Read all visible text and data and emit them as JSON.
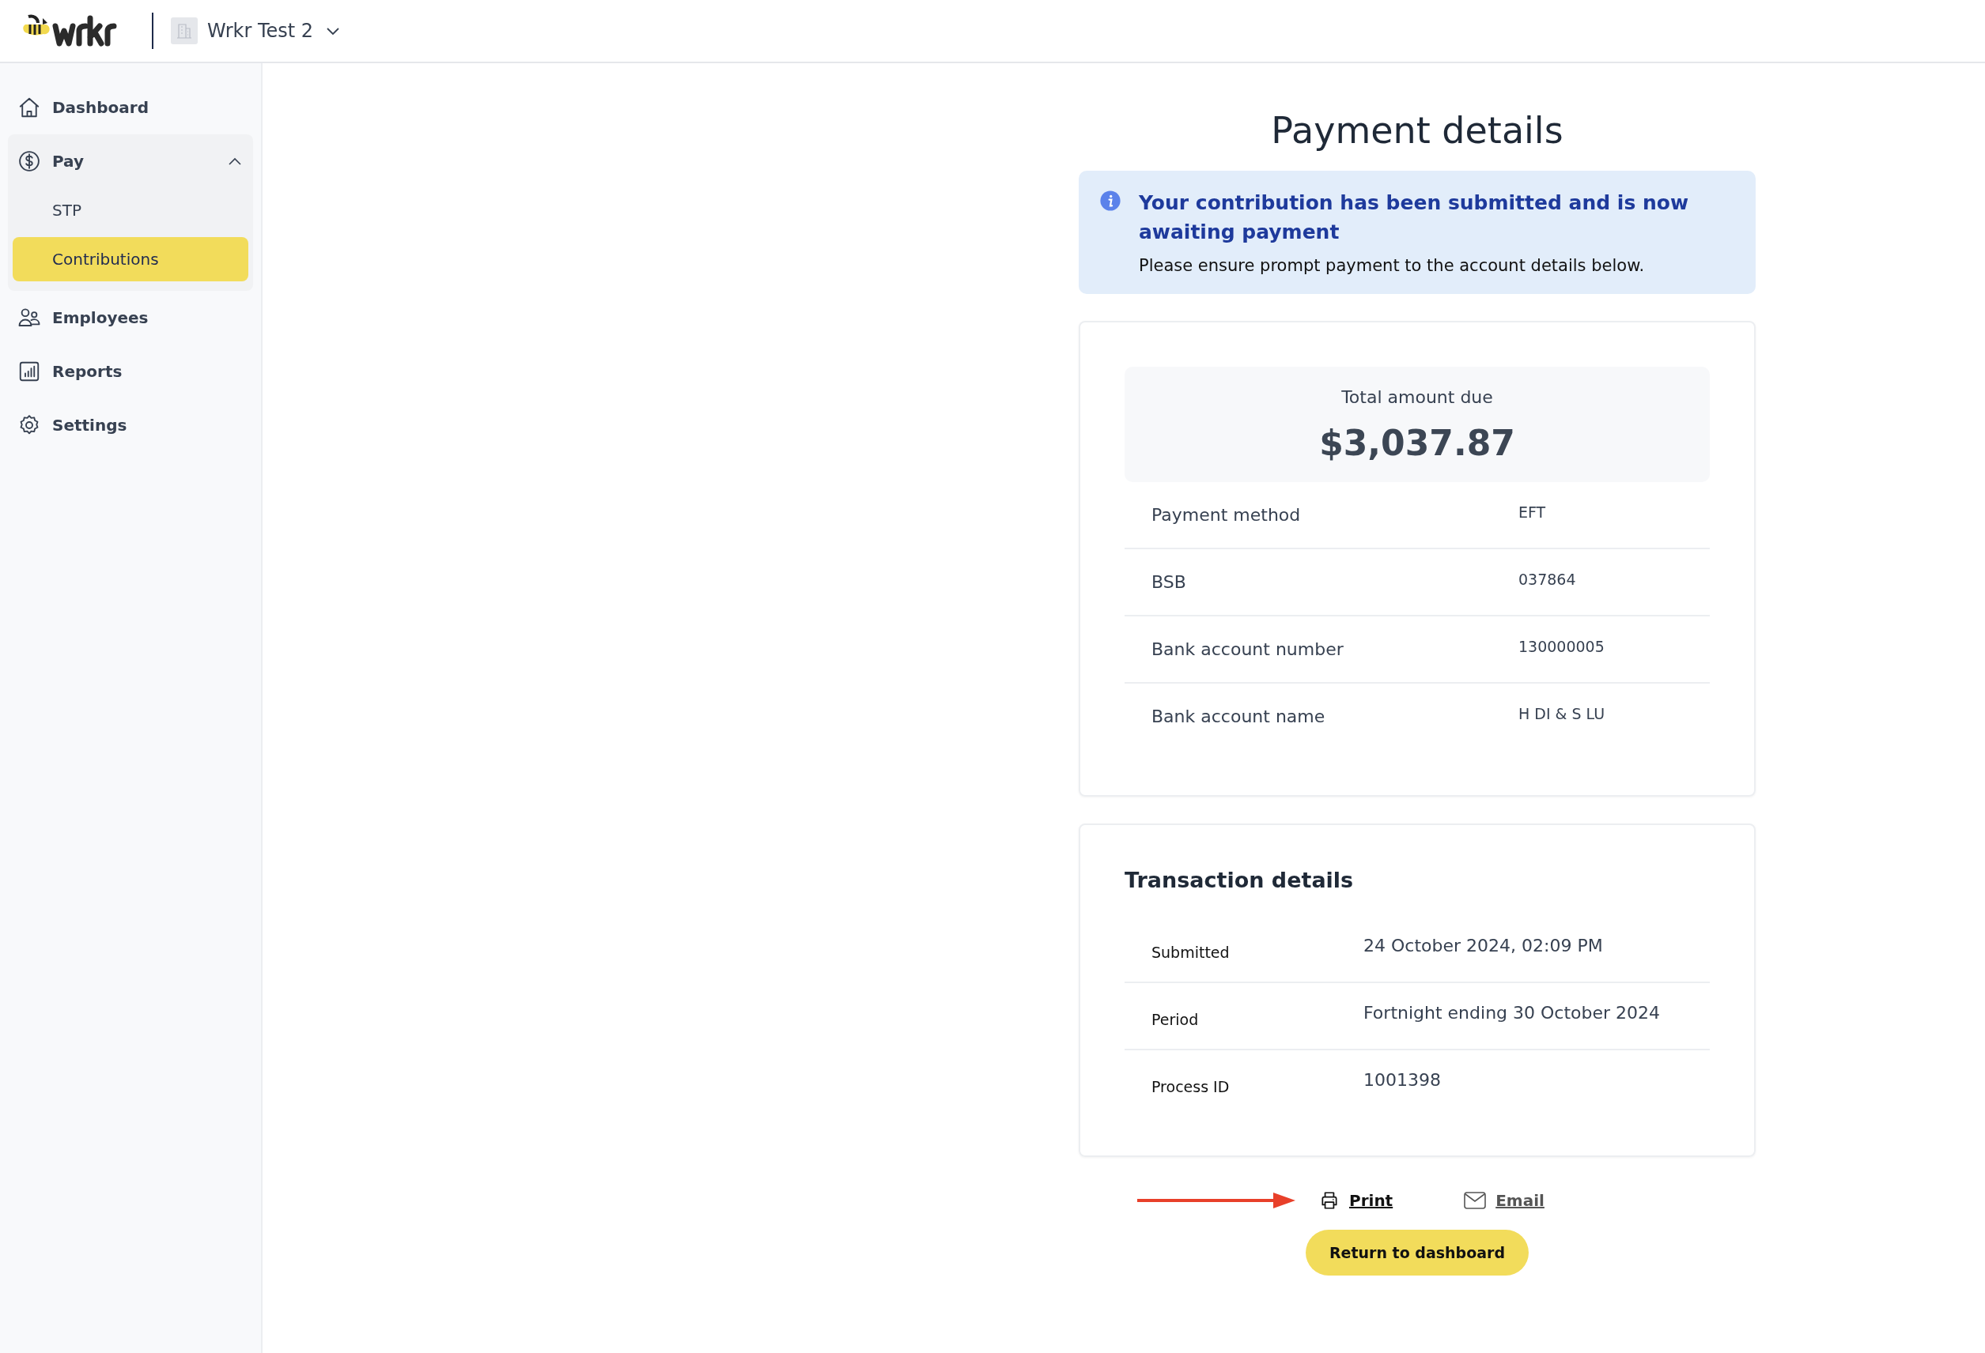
{
  "header": {
    "workspace": "Wrkr Test 2"
  },
  "sidebar": {
    "items": [
      {
        "label": "Dashboard",
        "selected": false
      },
      {
        "label": "Pay",
        "selected": false,
        "expanded": true,
        "children": [
          {
            "label": "STP",
            "selected": false
          },
          {
            "label": "Contributions",
            "selected": true
          }
        ]
      },
      {
        "label": "Employees",
        "selected": false
      },
      {
        "label": "Reports",
        "selected": false
      },
      {
        "label": "Settings",
        "selected": false
      }
    ]
  },
  "page_title": "Payment details",
  "alert": {
    "title": "Your contribution has been submitted and is now awaiting payment",
    "message": "Please ensure prompt payment to the account details below."
  },
  "payment": {
    "total_label": "Total amount due",
    "total": "$3,037.87",
    "rows": [
      {
        "label": "Payment method",
        "value": "EFT"
      },
      {
        "label": "BSB",
        "value": "037864"
      },
      {
        "label": "Bank account number",
        "value": "130000005"
      },
      {
        "label": "Bank account name",
        "value": "H DI & S LU"
      }
    ]
  },
  "transaction": {
    "title": "Transaction details",
    "rows": [
      {
        "label": "Submitted",
        "value": "24 October 2024, 02:09 PM"
      },
      {
        "label": "Period",
        "value": "Fortnight ending 30 October 2024"
      },
      {
        "label": "Process ID",
        "value": "1001398"
      }
    ]
  },
  "actions": {
    "print": "Print",
    "email": "Email",
    "button": "Return to dashboard"
  }
}
